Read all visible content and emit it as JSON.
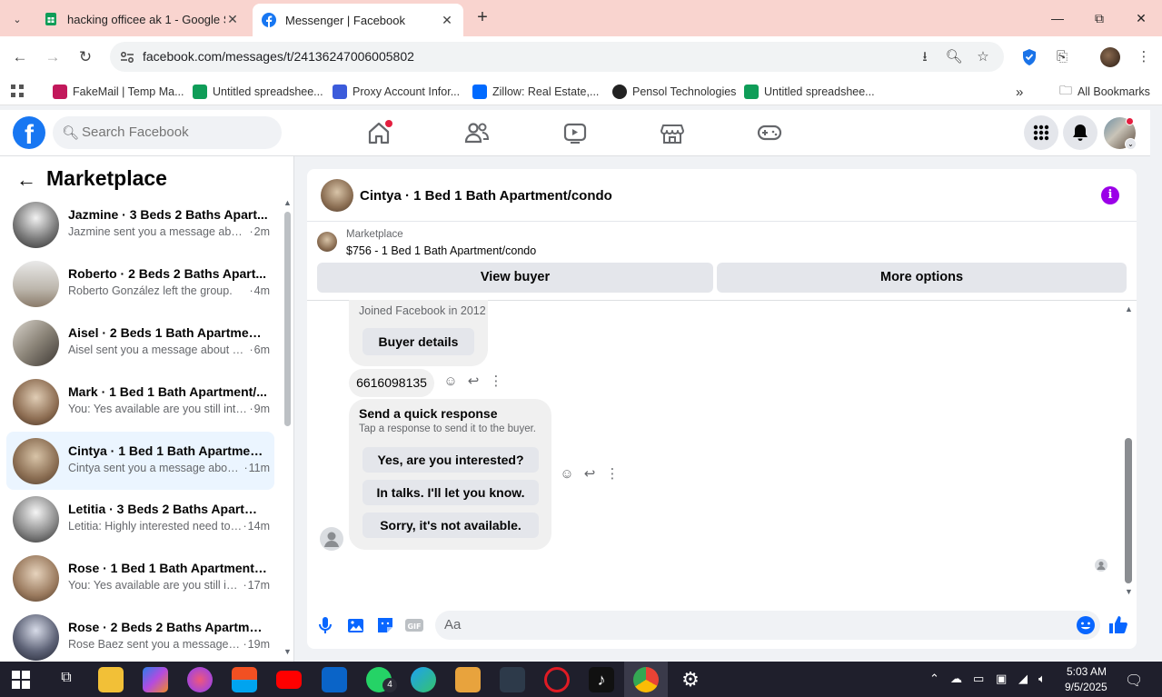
{
  "browser": {
    "tabs": [
      {
        "title": "hacking officee ak 1 - Google Sl",
        "active": false,
        "icon": "google-sheets-icon"
      },
      {
        "title": "Messenger | Facebook",
        "active": true,
        "icon": "facebook-icon"
      }
    ],
    "url": "facebook.com/messages/t/24136247006005802",
    "bookmarks": [
      {
        "label": "FakeMail | Temp Ma...",
        "icon": "fakemail-icon",
        "color": "#c2185b"
      },
      {
        "label": "Untitled spreadshee...",
        "icon": "google-sheets-icon",
        "color": "#0f9d58"
      },
      {
        "label": "Proxy Account Infor...",
        "icon": "proxy-icon",
        "color": "#3b5bdb"
      },
      {
        "label": "Zillow: Real Estate,...",
        "icon": "zillow-icon",
        "color": "#006aff"
      },
      {
        "label": "Pensol Technologies",
        "icon": "pensol-icon",
        "color": "#222222"
      },
      {
        "label": "Untitled spreadshee...",
        "icon": "google-sheets-icon",
        "color": "#0f9d58"
      }
    ],
    "all_bookmarks": "All Bookmarks"
  },
  "facebook": {
    "logo": "f",
    "search_placeholder": "Search Facebook"
  },
  "sidebar": {
    "title": "Marketplace",
    "conversations": [
      {
        "name": "Jazmine · 3 Beds 2 Baths Apart...",
        "snippet": "Jazmine sent you a message about...",
        "time": "2m",
        "selected": false
      },
      {
        "name": "Roberto · 2 Beds 2 Baths Apart...",
        "snippet": "Roberto González left the group.",
        "time": "4m",
        "selected": false
      },
      {
        "name": "Aisel · 2 Beds 1 Bath Apartment/...",
        "snippet": "Aisel sent you a message about yo...",
        "time": "6m",
        "selected": false
      },
      {
        "name": "Mark · 1 Bed 1 Bath Apartment/...",
        "snippet": "You: Yes available are you still inter...",
        "time": "9m",
        "selected": false
      },
      {
        "name": "Cintya · 1 Bed 1 Bath Apartment...",
        "snippet": "Cintya sent you a message about...",
        "time": "11m",
        "selected": true
      },
      {
        "name": "Letitia · 3 Beds 2 Baths Apartme...",
        "snippet": "Letitia: Highly interested need to ...",
        "time": "14m",
        "selected": false
      },
      {
        "name": "Rose · 1 Bed 1 Bath Apartment/c...",
        "snippet": "You: Yes available are you still int...",
        "time": "17m",
        "selected": false
      },
      {
        "name": "Rose · 2 Beds 2 Baths Apartmen...",
        "snippet": "Rose Baez sent you a message a...",
        "time": "19m",
        "selected": false
      }
    ]
  },
  "chat": {
    "title": "Cintya · 1 Bed 1 Bath Apartment/condo",
    "marketplace_label": "Marketplace",
    "listing": "$756 - 1 Bed 1 Bath Apartment/condo",
    "view_buyer": "View buyer",
    "more_options": "More options",
    "joined": "Joined Facebook in 2012",
    "buyer_details": "Buyer details",
    "phone": "6616098135",
    "quick_title": "Send a quick response",
    "quick_subtitle": "Tap a response to send it to the buyer.",
    "quick_replies": [
      "Yes, are you interested?",
      "In talks. I'll let you know.",
      "Sorry, it's not available."
    ],
    "composer_placeholder": "Aa"
  },
  "taskbar": {
    "time": "5:03 AM",
    "date": "9/5/2025",
    "whatsapp_badge": "4"
  },
  "colors": {
    "facebook_blue": "#1877f2",
    "tab_strip": "#f9d4cf",
    "selected_row": "#ebf5ff",
    "info_purple": "#9b00e8"
  }
}
